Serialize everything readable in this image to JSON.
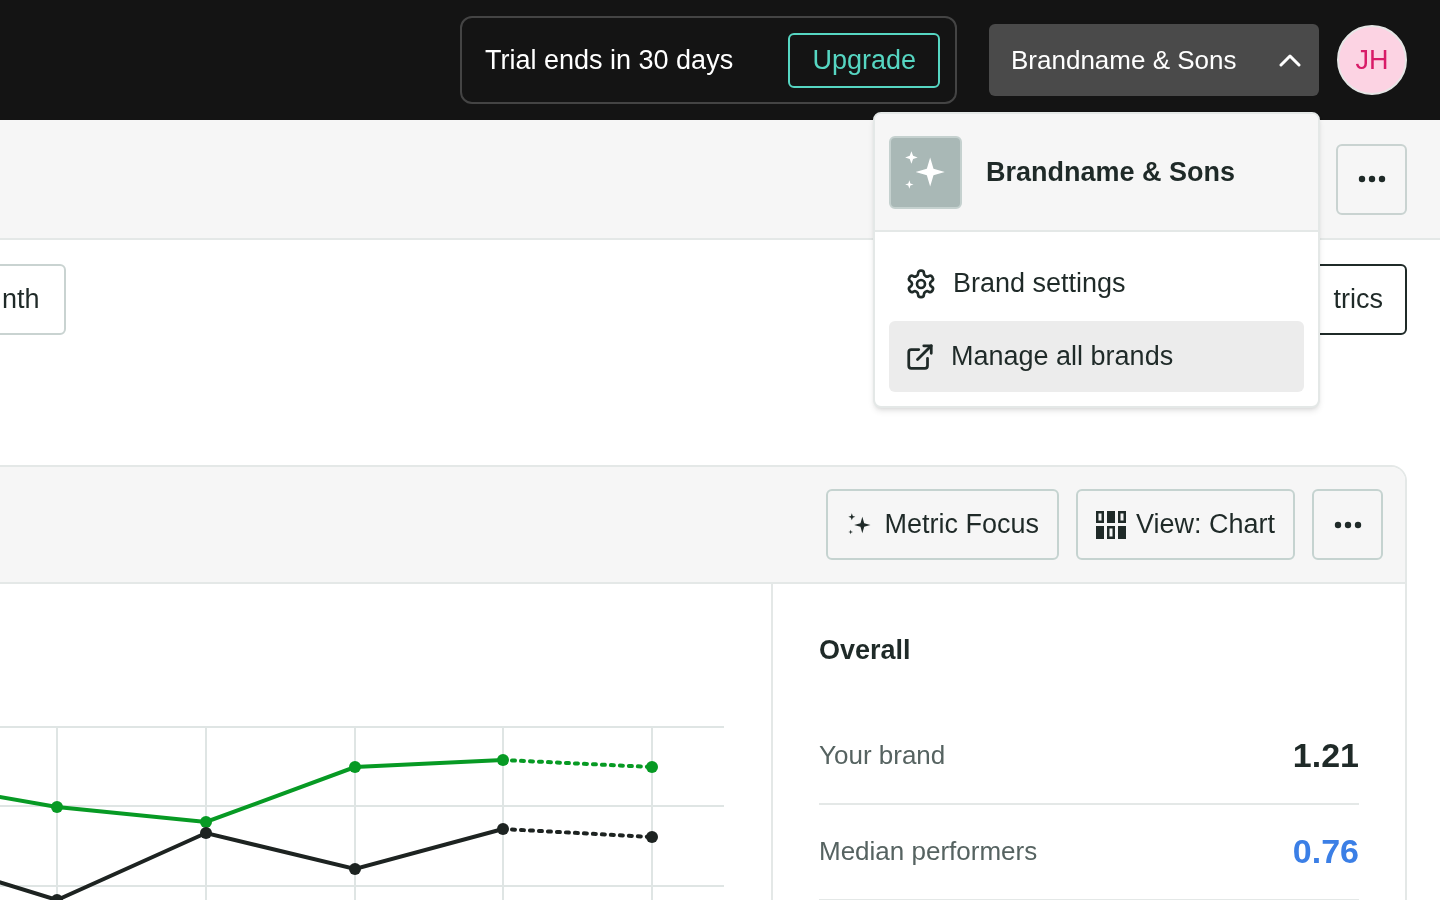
{
  "top_bar": {
    "trial": {
      "text": "Trial ends in 30 days",
      "button": "Upgrade"
    },
    "brand_switcher": {
      "label": "Brandname & Sons",
      "expanded": true
    },
    "avatar": "JH"
  },
  "filters": [
    {
      "label": "nth"
    },
    {
      "label": "trics"
    }
  ],
  "brand_menu": {
    "brand": "Brandname & Sons",
    "items": [
      {
        "label": "Brand settings",
        "kind": "settings",
        "selected": false
      },
      {
        "label": "Manage all brands",
        "kind": "external",
        "selected": true
      }
    ]
  },
  "card": {
    "toolbar": [
      {
        "label": "Metric Focus",
        "kind": "sparkle"
      },
      {
        "label": "View: Chart",
        "kind": "grid"
      }
    ],
    "summary": {
      "title": "Overall",
      "rows": [
        {
          "label": "Your brand",
          "value": "1.21",
          "color": "#1f2a28"
        },
        {
          "label": "Median performers",
          "value": "0.76",
          "color": "#3b7fe6"
        }
      ]
    }
  }
}
